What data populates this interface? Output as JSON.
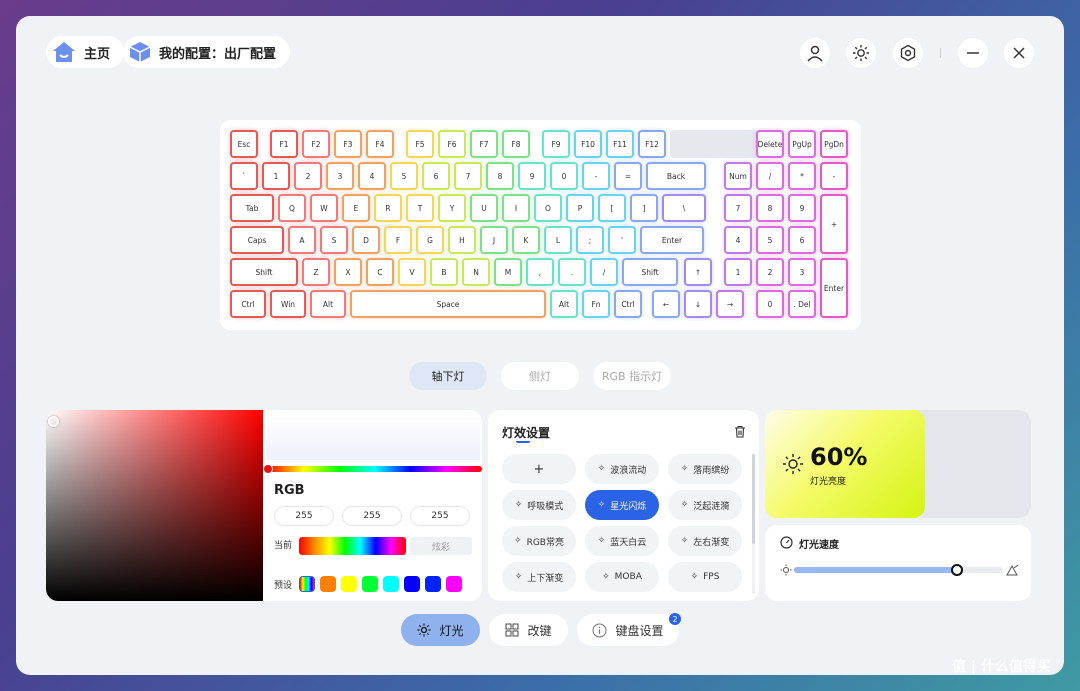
{
  "nav": {
    "home": "主页",
    "config": "我的配置：出厂配置"
  },
  "zones": [
    "轴下灯",
    "侧灯",
    "RGB 指示灯"
  ],
  "rgb": {
    "title": "RGB",
    "r": "255",
    "g": "255",
    "b": "255",
    "current_label": "当前",
    "current_mode": "炫彩",
    "preset_label": "预设",
    "presets": [
      "rainbow",
      "#ff8000",
      "#ffff00",
      "#00ff33",
      "#00ffff",
      "#0000ff",
      "#0022ff",
      "#ff00ff"
    ]
  },
  "effects": {
    "title": "灯效设置",
    "items": [
      "+",
      "波浪流动",
      "落雨缤纷",
      "呼吸模式",
      "星光闪烁",
      "泛起涟漪",
      "RGB常亮",
      "蓝天白云",
      "左右渐变",
      "上下渐变",
      "MOBA",
      "FPS"
    ],
    "active": "星光闪烁"
  },
  "brightness": {
    "value": "60%",
    "label": "灯光亮度",
    "level": 0.6
  },
  "speed": {
    "label": "灯光速度",
    "level": 0.78
  },
  "bottom": [
    "灯光",
    "改键",
    "键盘设置"
  ],
  "badge": "2",
  "watermark": "值 | 什么值得买",
  "keys": [
    [
      "Esc",
      "F1",
      "F2",
      "F3",
      "F4",
      "F5",
      "F6",
      "F7",
      "F8",
      "F9",
      "F10",
      "F11",
      "F12",
      "",
      "Delete",
      "PgUp",
      "PgDn"
    ],
    [
      "`",
      "1",
      "2",
      "3",
      "4",
      "5",
      "6",
      "7",
      "8",
      "9",
      "0",
      "-",
      "=",
      "Back",
      "Num",
      "/",
      "*",
      "-"
    ],
    [
      "Tab",
      "Q",
      "W",
      "E",
      "R",
      "T",
      "Y",
      "U",
      "I",
      "O",
      "P",
      "[",
      "]",
      "\\",
      "7",
      "8",
      "9",
      "+"
    ],
    [
      "Caps",
      "A",
      "S",
      "D",
      "F",
      "G",
      "H",
      "J",
      "K",
      "L",
      ";",
      "'",
      "Enter",
      "4",
      "5",
      "6"
    ],
    [
      "Shift",
      "Z",
      "X",
      "C",
      "V",
      "B",
      "N",
      "M",
      ",",
      ".",
      "/",
      "Shift",
      "↑",
      "1",
      "2",
      "3",
      "Enter"
    ],
    [
      "Ctrl",
      "Win",
      "Alt",
      "Space",
      "Alt",
      "Fn",
      "Ctrl",
      "←",
      "↓",
      "→",
      "0",
      ". Del"
    ]
  ]
}
